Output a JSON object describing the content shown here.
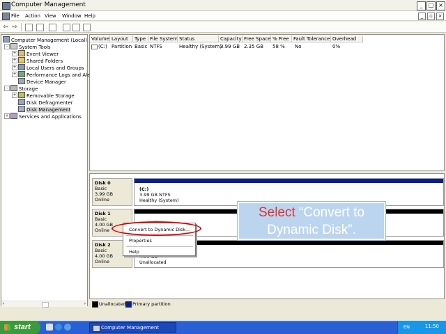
{
  "window": {
    "title": "Computer Management"
  },
  "menu": [
    "File",
    "Action",
    "View",
    "Window",
    "Help"
  ],
  "tree": [
    {
      "label": "Computer Management (Local)",
      "level": 0,
      "exp": "-"
    },
    {
      "label": "System Tools",
      "level": 1,
      "exp": "-"
    },
    {
      "label": "Event Viewer",
      "level": 2,
      "exp": "+"
    },
    {
      "label": "Shared Folders",
      "level": 2,
      "exp": "+"
    },
    {
      "label": "Local Users and Groups",
      "level": 2,
      "exp": "+"
    },
    {
      "label": "Performance Logs and Alerts",
      "level": 2,
      "exp": "+"
    },
    {
      "label": "Device Manager",
      "level": 2,
      "exp": ""
    },
    {
      "label": "Storage",
      "level": 1,
      "exp": "-"
    },
    {
      "label": "Removable Storage",
      "level": 2,
      "exp": "+"
    },
    {
      "label": "Disk Defragmenter",
      "level": 2,
      "exp": ""
    },
    {
      "label": "Disk Management",
      "level": 2,
      "exp": "",
      "selected": true
    },
    {
      "label": "Services and Applications",
      "level": 1,
      "exp": "+"
    }
  ],
  "volume_table": {
    "columns": [
      "Volume",
      "Layout",
      "Type",
      "File System",
      "Status",
      "Capacity",
      "Free Space",
      "% Free",
      "Fault Tolerance",
      "Overhead"
    ],
    "rows": [
      [
        "(C:)",
        "Partition",
        "Basic",
        "NTFS",
        "Healthy (System)",
        "3.99 GB",
        "2.35 GB",
        "58 %",
        "No",
        "0%"
      ]
    ]
  },
  "disks": [
    {
      "name": "Disk 0",
      "type": "Basic",
      "size": "3.99 GB",
      "state": "Online",
      "part_title": "(C:)",
      "part_line1": "3.99 GB NTFS",
      "part_line2": "Healthy (System)",
      "bar_color": "#0a1f8c"
    },
    {
      "name": "Disk 1",
      "type": "Basic",
      "size": "4.00 GB",
      "state": "Online",
      "part_title": "",
      "part_line1": "",
      "part_line2": "",
      "bar_color": "#000000"
    },
    {
      "name": "Disk 2",
      "type": "Basic",
      "size": "4.00 GB",
      "state": "Online",
      "part_title": "",
      "part_line1": "4.00 GB",
      "part_line2": "Unallocated",
      "bar_color": "#000000"
    }
  ],
  "context_menu": {
    "items": [
      "Convert to Dynamic Disk...",
      "Properties",
      "Help"
    ]
  },
  "legend": [
    {
      "label": "Unallocated",
      "color": "#000000"
    },
    {
      "label": "Primary partition",
      "color": "#0a1f8c"
    }
  ],
  "callout": {
    "part1": "Select ",
    "part2": "“Convert to",
    "part3": "Dynamic Disk”."
  },
  "taskbar": {
    "start_label": "start",
    "task_label": "Computer Management",
    "clock": "11:50",
    "lang": "EN"
  }
}
